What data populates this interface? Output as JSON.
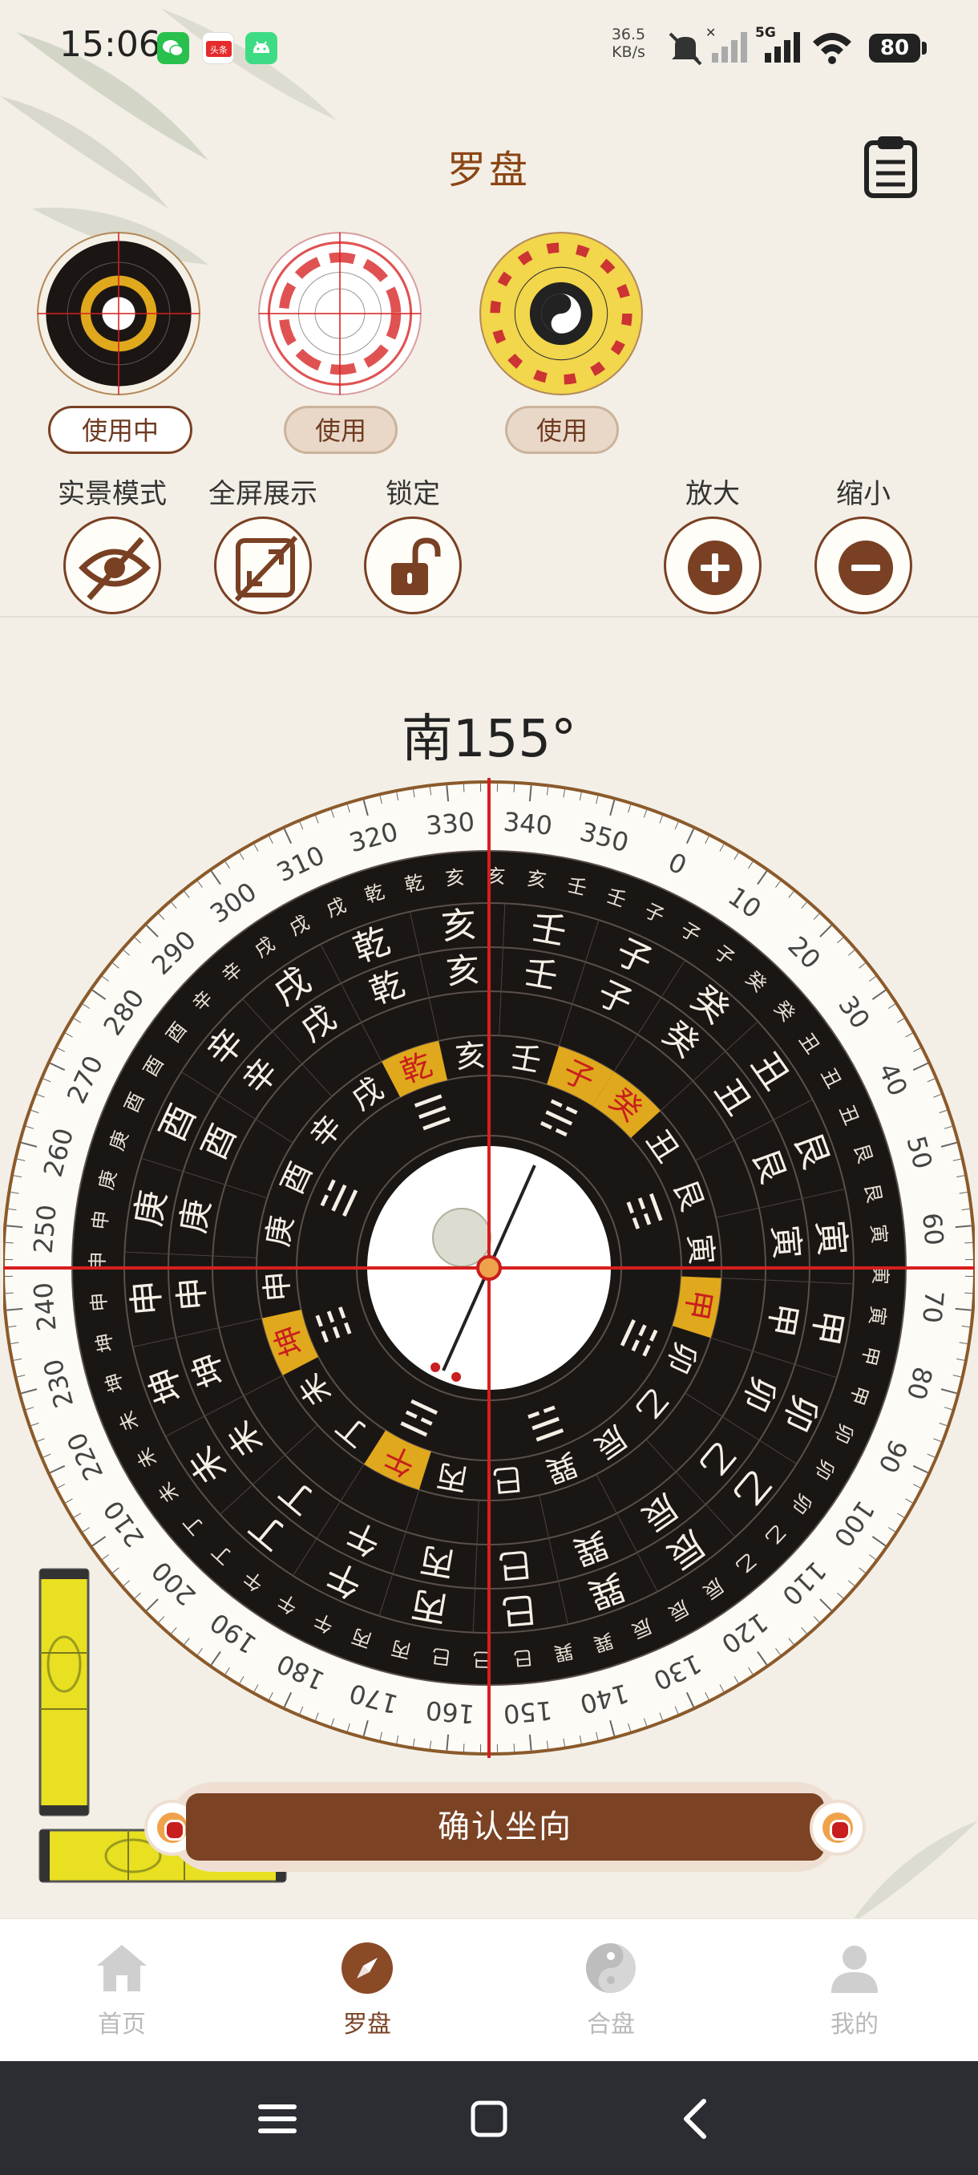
{
  "status_bar": {
    "time": "15:06",
    "net_speed_value": "36.5",
    "net_speed_unit": "KB/s",
    "network": "5G",
    "battery": "80",
    "app_icons": [
      "wechat-icon",
      "toutiao-icon",
      "android-icon"
    ],
    "toutiao_label": "头条"
  },
  "header": {
    "title": "罗盘",
    "clipboard_icon": "clipboard-icon"
  },
  "compass_styles": [
    {
      "button": "使用中",
      "state": "active"
    },
    {
      "button": "使用",
      "state": "idle"
    },
    {
      "button": "使用",
      "state": "idle"
    }
  ],
  "tools": {
    "live_mode": "实景模式",
    "fullscreen": "全屏展示",
    "lock": "锁定",
    "zoom_in": "放大",
    "zoom_out": "缩小"
  },
  "heading": {
    "direction": "南",
    "degrees": "155°"
  },
  "compass": {
    "heading_deg": 155,
    "degree_ticks": [
      "0",
      "10",
      "20",
      "30",
      "40",
      "50",
      "60",
      "70",
      "80",
      "90",
      "100",
      "110",
      "120",
      "130",
      "140",
      "150",
      "160",
      "170",
      "180",
      "190",
      "200",
      "210",
      "220",
      "230",
      "240",
      "250",
      "260",
      "270",
      "280",
      "290",
      "300",
      "310",
      "320",
      "330",
      "340",
      "350"
    ],
    "mountains_24": [
      "子",
      "癸",
      "丑",
      "艮",
      "寅",
      "甲",
      "卯",
      "乙",
      "辰",
      "巽",
      "巳",
      "丙",
      "午",
      "丁",
      "未",
      "坤",
      "申",
      "庚",
      "酉",
      "辛",
      "戌",
      "乾",
      "亥",
      "壬"
    ],
    "trigrams_8": [
      "☵",
      "☶",
      "☳",
      "☴",
      "☲",
      "☷",
      "☱",
      "☰"
    ],
    "highlighted": [
      "午",
      "坤",
      "申",
      "戊",
      "乾",
      "壬",
      "子",
      "癸",
      "寅",
      "甲",
      "乙",
      "辰"
    ]
  },
  "confirm": {
    "label": "确认坐向"
  },
  "bottom_nav": [
    {
      "label": "首页",
      "icon": "home-icon",
      "active": false
    },
    {
      "label": "罗盘",
      "icon": "compass-icon",
      "active": true
    },
    {
      "label": "合盘",
      "icon": "yin-yang-icon",
      "active": false
    },
    {
      "label": "我的",
      "icon": "user-icon",
      "active": false
    }
  ],
  "colors": {
    "brand_brown": "#7b4324",
    "title_brown": "#8b4513",
    "gold": "#e0a81c",
    "crosshair_red": "#d81e1e",
    "background": "#f3efe6"
  }
}
